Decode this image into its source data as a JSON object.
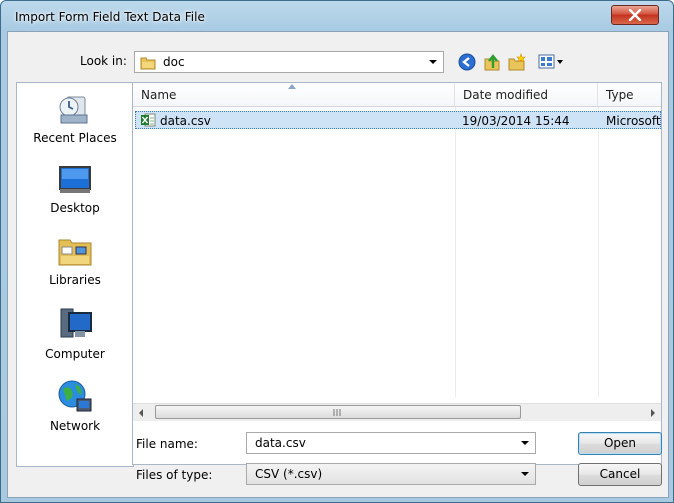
{
  "window": {
    "title": "Import Form Field Text Data File"
  },
  "toolbar": {
    "look_in_label": "Look in:",
    "look_in_value": "doc"
  },
  "places": [
    {
      "label": "Recent Places",
      "icon": "recent-places-icon"
    },
    {
      "label": "Desktop",
      "icon": "desktop-icon"
    },
    {
      "label": "Libraries",
      "icon": "libraries-icon"
    },
    {
      "label": "Computer",
      "icon": "computer-icon"
    },
    {
      "label": "Network",
      "icon": "network-icon"
    }
  ],
  "list": {
    "columns": [
      "Name",
      "Date modified",
      "Type"
    ],
    "rows": [
      {
        "name": "data.csv",
        "date": "19/03/2014 15:44",
        "type": "Microsoft"
      }
    ]
  },
  "form": {
    "file_name_label": "File name:",
    "file_name_value": "data.csv",
    "file_type_label": "Files of type:",
    "file_type_value": "CSV (*.csv)"
  },
  "buttons": {
    "open": "Open",
    "cancel": "Cancel"
  }
}
